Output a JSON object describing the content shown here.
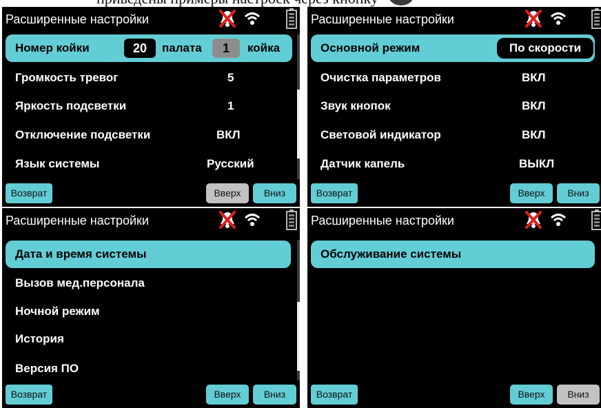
{
  "caption": {
    "text": "приведены примеры настроек через кнопку"
  },
  "panel_title": "Расширенные настройки",
  "status": {
    "alarm_icon": "alarm-off-icon",
    "wifi_icon": "wifi-icon",
    "battery_icon": "battery-icon"
  },
  "buttons": {
    "back": "Возврат",
    "up": "Вверх",
    "down": "Вниз"
  },
  "colors": {
    "accent": "#63cdd5",
    "background": "#000000",
    "disabled": "#c2c2c2",
    "alarm_x": "#e02020"
  },
  "panel1": {
    "row1": {
      "label": "Номер койки",
      "room_value": "20",
      "room_label": "палата",
      "bed_value": "1",
      "bed_label": "койка"
    },
    "row2": {
      "label": "Громкость тревог",
      "value": "5"
    },
    "row3": {
      "label": "Яркость подсветки",
      "value": "1"
    },
    "row4": {
      "label": "Отключение подсветки",
      "value": "ВКЛ"
    },
    "row5": {
      "label": "Язык системы",
      "value": "Русский"
    }
  },
  "panel2": {
    "row1": {
      "label": "Основной режим",
      "value": "По скорости"
    },
    "row2": {
      "label": "Очистка параметров",
      "value": "ВКЛ"
    },
    "row3": {
      "label": "Звук кнопок",
      "value": "ВКЛ"
    },
    "row4": {
      "label": "Световой индикатор",
      "value": "ВКЛ"
    },
    "row5": {
      "label": "Датчик капель",
      "value": "ВЫКЛ"
    }
  },
  "panel3": {
    "items": [
      "Дата и время системы",
      "Вызов мед.персонала",
      "Ночной режим",
      "История",
      "Версия ПО"
    ]
  },
  "panel4": {
    "items": [
      "Обслуживание системы"
    ]
  }
}
